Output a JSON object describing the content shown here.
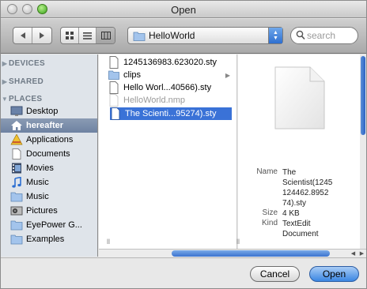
{
  "window": {
    "title": "Open"
  },
  "toolbar": {
    "back_icon": "back-arrow-icon",
    "forward_icon": "forward-arrow-icon",
    "view_modes": [
      "icon-view-icon",
      "list-view-icon",
      "column-view-icon"
    ],
    "active_view": "column",
    "location": "HelloWorld",
    "search_placeholder": "search"
  },
  "sidebar": {
    "sections": {
      "devices": "DEVICES",
      "shared": "SHARED",
      "places": "PLACES"
    },
    "items": [
      {
        "label": "Desktop",
        "icon": "desktop-icon"
      },
      {
        "label": "hereafter",
        "icon": "home-icon",
        "selected": true
      },
      {
        "label": "Applications",
        "icon": "applications-icon"
      },
      {
        "label": "Documents",
        "icon": "documents-icon"
      },
      {
        "label": "Movies",
        "icon": "movies-icon"
      },
      {
        "label": "Music",
        "icon": "music-icon"
      },
      {
        "label": "Music",
        "icon": "folder-icon"
      },
      {
        "label": "Pictures",
        "icon": "pictures-icon"
      },
      {
        "label": "EyePower G...",
        "icon": "folder-icon"
      },
      {
        "label": "Examples",
        "icon": "folder-icon"
      }
    ]
  },
  "files": [
    {
      "name": "1245136983.623020.sty",
      "icon": "document-icon"
    },
    {
      "name": "clips",
      "icon": "folder-icon",
      "has_children": true
    },
    {
      "name": "Hello Worl...40566).sty",
      "icon": "document-icon"
    },
    {
      "name": "HelloWorld.nmp",
      "icon": "document-icon",
      "disabled": true
    },
    {
      "name": "The Scienti...95274).sty",
      "icon": "document-icon",
      "selected": true
    }
  ],
  "preview": {
    "name_label": "Name",
    "name_lines": [
      "The",
      "Scientist(1245",
      "124462.8952",
      "74).sty"
    ],
    "size_label": "Size",
    "size_value": "4 KB",
    "kind_label": "Kind",
    "kind_lines": [
      "TextEdit",
      "Document"
    ]
  },
  "buttons": {
    "cancel": "Cancel",
    "open": "Open"
  },
  "colors": {
    "selection": "#3a72d7",
    "sidebar_bg": "#dfe4ea",
    "default_button": "#3b86e2"
  }
}
